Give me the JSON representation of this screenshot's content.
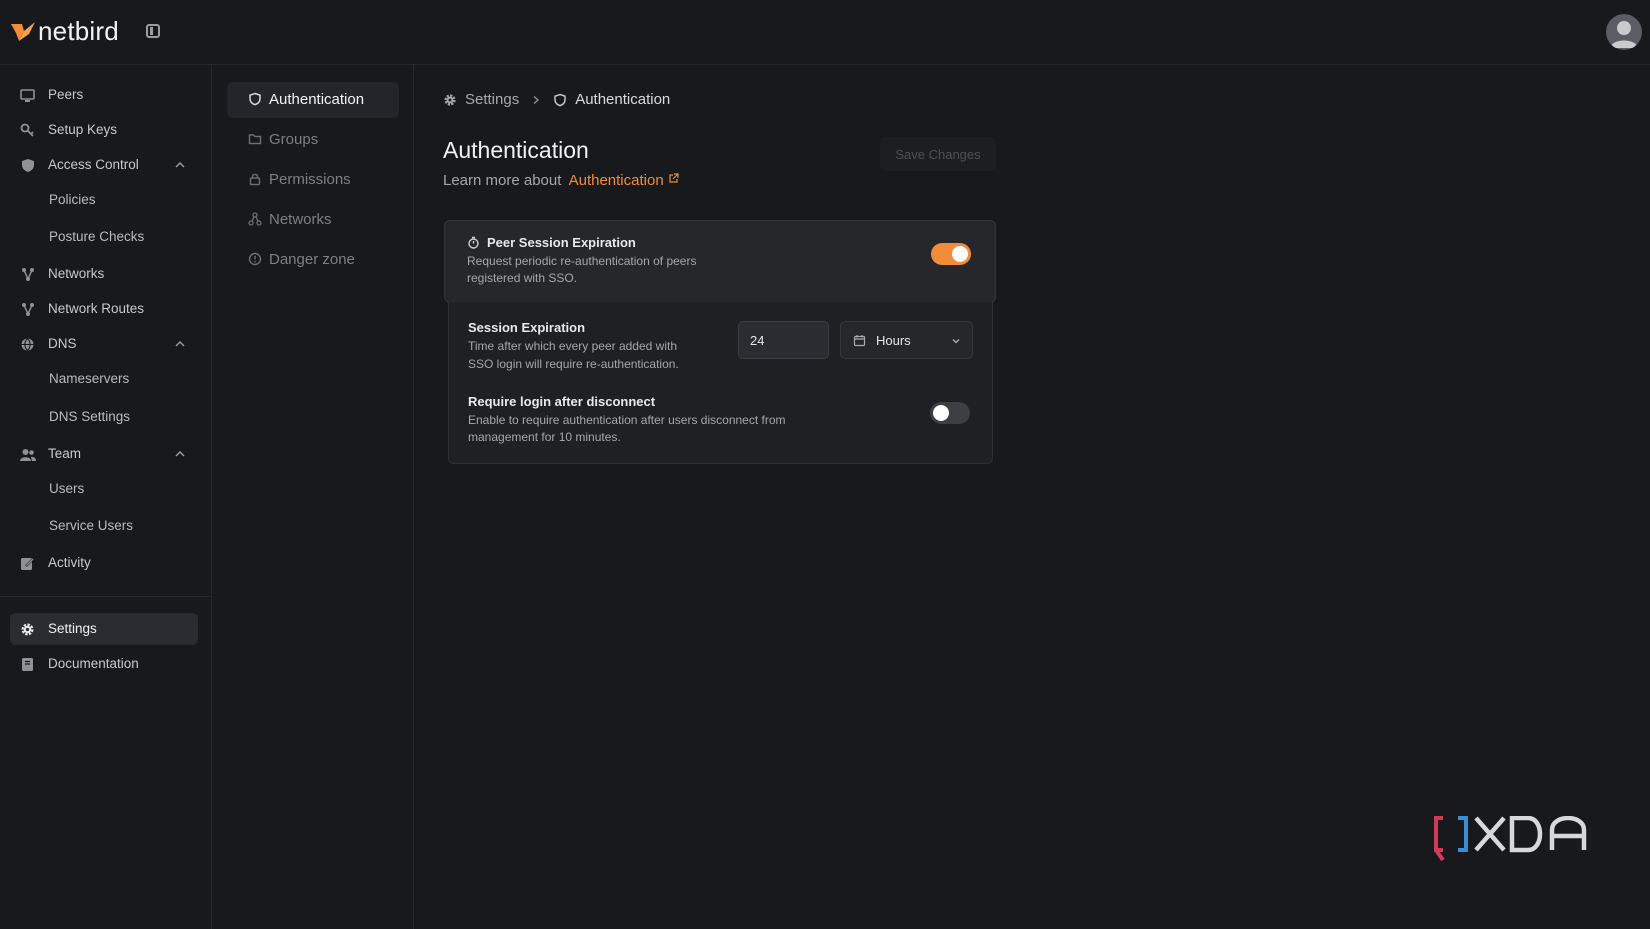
{
  "brand": {
    "name": "netbird"
  },
  "sidebar": {
    "items": [
      {
        "label": "Peers",
        "icon": "monitor-icon"
      },
      {
        "label": "Setup Keys",
        "icon": "key-icon"
      },
      {
        "label": "Access Control",
        "icon": "shield-icon",
        "expanded": true,
        "children": [
          "Policies",
          "Posture Checks"
        ]
      },
      {
        "label": "Networks",
        "icon": "network-icon"
      },
      {
        "label": "Network Routes",
        "icon": "route-icon"
      },
      {
        "label": "DNS",
        "icon": "globe-icon",
        "expanded": true,
        "children": [
          "Nameservers",
          "DNS Settings"
        ]
      },
      {
        "label": "Team",
        "icon": "users-icon",
        "expanded": true,
        "children": [
          "Users",
          "Service Users"
        ]
      },
      {
        "label": "Activity",
        "icon": "activity-icon"
      },
      {
        "label": "Settings",
        "icon": "gear-icon",
        "active": true
      },
      {
        "label": "Documentation",
        "icon": "book-icon"
      }
    ]
  },
  "settings_nav": {
    "items": [
      {
        "label": "Authentication",
        "icon": "shield-icon",
        "active": true
      },
      {
        "label": "Groups",
        "icon": "folder-icon"
      },
      {
        "label": "Permissions",
        "icon": "lock-icon"
      },
      {
        "label": "Networks",
        "icon": "network-icon"
      },
      {
        "label": "Danger zone",
        "icon": "alert-icon"
      }
    ]
  },
  "breadcrumb": {
    "parent": "Settings",
    "current": "Authentication"
  },
  "main": {
    "title": "Authentication",
    "learn_prefix": "Learn more about",
    "learn_link": "Authentication",
    "save_label": "Save Changes",
    "peer_session": {
      "title": "Peer Session Expiration",
      "desc_line1": "Request periodic re-authentication of peers",
      "desc_line2": "registered with SSO.",
      "enabled": true
    },
    "session_expiration": {
      "title": "Session Expiration",
      "desc_line1": "Time after which every peer added with",
      "desc_line2": "SSO login will require re-authentication.",
      "value": "24",
      "unit": "Hours"
    },
    "login_after_disconnect": {
      "title": "Require login after disconnect",
      "desc_line1": "Enable to require authentication after users disconnect from",
      "desc_line2": "management for 10 minutes.",
      "enabled": false
    }
  },
  "colors": {
    "accent": "#f08c3a",
    "background": "#18191c"
  },
  "watermark": "XDA"
}
